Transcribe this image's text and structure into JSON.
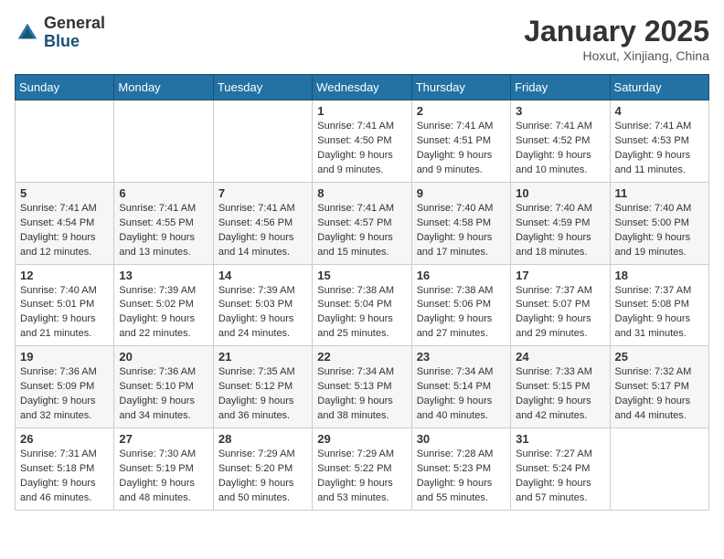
{
  "header": {
    "logo_general": "General",
    "logo_blue": "Blue",
    "month_title": "January 2025",
    "location": "Hoxut, Xinjiang, China"
  },
  "days_of_week": [
    "Sunday",
    "Monday",
    "Tuesday",
    "Wednesday",
    "Thursday",
    "Friday",
    "Saturday"
  ],
  "weeks": [
    [
      {
        "day": "",
        "info": ""
      },
      {
        "day": "",
        "info": ""
      },
      {
        "day": "",
        "info": ""
      },
      {
        "day": "1",
        "info": "Sunrise: 7:41 AM\nSunset: 4:50 PM\nDaylight: 9 hours\nand 9 minutes."
      },
      {
        "day": "2",
        "info": "Sunrise: 7:41 AM\nSunset: 4:51 PM\nDaylight: 9 hours\nand 9 minutes."
      },
      {
        "day": "3",
        "info": "Sunrise: 7:41 AM\nSunset: 4:52 PM\nDaylight: 9 hours\nand 10 minutes."
      },
      {
        "day": "4",
        "info": "Sunrise: 7:41 AM\nSunset: 4:53 PM\nDaylight: 9 hours\nand 11 minutes."
      }
    ],
    [
      {
        "day": "5",
        "info": "Sunrise: 7:41 AM\nSunset: 4:54 PM\nDaylight: 9 hours\nand 12 minutes."
      },
      {
        "day": "6",
        "info": "Sunrise: 7:41 AM\nSunset: 4:55 PM\nDaylight: 9 hours\nand 13 minutes."
      },
      {
        "day": "7",
        "info": "Sunrise: 7:41 AM\nSunset: 4:56 PM\nDaylight: 9 hours\nand 14 minutes."
      },
      {
        "day": "8",
        "info": "Sunrise: 7:41 AM\nSunset: 4:57 PM\nDaylight: 9 hours\nand 15 minutes."
      },
      {
        "day": "9",
        "info": "Sunrise: 7:40 AM\nSunset: 4:58 PM\nDaylight: 9 hours\nand 17 minutes."
      },
      {
        "day": "10",
        "info": "Sunrise: 7:40 AM\nSunset: 4:59 PM\nDaylight: 9 hours\nand 18 minutes."
      },
      {
        "day": "11",
        "info": "Sunrise: 7:40 AM\nSunset: 5:00 PM\nDaylight: 9 hours\nand 19 minutes."
      }
    ],
    [
      {
        "day": "12",
        "info": "Sunrise: 7:40 AM\nSunset: 5:01 PM\nDaylight: 9 hours\nand 21 minutes."
      },
      {
        "day": "13",
        "info": "Sunrise: 7:39 AM\nSunset: 5:02 PM\nDaylight: 9 hours\nand 22 minutes."
      },
      {
        "day": "14",
        "info": "Sunrise: 7:39 AM\nSunset: 5:03 PM\nDaylight: 9 hours\nand 24 minutes."
      },
      {
        "day": "15",
        "info": "Sunrise: 7:38 AM\nSunset: 5:04 PM\nDaylight: 9 hours\nand 25 minutes."
      },
      {
        "day": "16",
        "info": "Sunrise: 7:38 AM\nSunset: 5:06 PM\nDaylight: 9 hours\nand 27 minutes."
      },
      {
        "day": "17",
        "info": "Sunrise: 7:37 AM\nSunset: 5:07 PM\nDaylight: 9 hours\nand 29 minutes."
      },
      {
        "day": "18",
        "info": "Sunrise: 7:37 AM\nSunset: 5:08 PM\nDaylight: 9 hours\nand 31 minutes."
      }
    ],
    [
      {
        "day": "19",
        "info": "Sunrise: 7:36 AM\nSunset: 5:09 PM\nDaylight: 9 hours\nand 32 minutes."
      },
      {
        "day": "20",
        "info": "Sunrise: 7:36 AM\nSunset: 5:10 PM\nDaylight: 9 hours\nand 34 minutes."
      },
      {
        "day": "21",
        "info": "Sunrise: 7:35 AM\nSunset: 5:12 PM\nDaylight: 9 hours\nand 36 minutes."
      },
      {
        "day": "22",
        "info": "Sunrise: 7:34 AM\nSunset: 5:13 PM\nDaylight: 9 hours\nand 38 minutes."
      },
      {
        "day": "23",
        "info": "Sunrise: 7:34 AM\nSunset: 5:14 PM\nDaylight: 9 hours\nand 40 minutes."
      },
      {
        "day": "24",
        "info": "Sunrise: 7:33 AM\nSunset: 5:15 PM\nDaylight: 9 hours\nand 42 minutes."
      },
      {
        "day": "25",
        "info": "Sunrise: 7:32 AM\nSunset: 5:17 PM\nDaylight: 9 hours\nand 44 minutes."
      }
    ],
    [
      {
        "day": "26",
        "info": "Sunrise: 7:31 AM\nSunset: 5:18 PM\nDaylight: 9 hours\nand 46 minutes."
      },
      {
        "day": "27",
        "info": "Sunrise: 7:30 AM\nSunset: 5:19 PM\nDaylight: 9 hours\nand 48 minutes."
      },
      {
        "day": "28",
        "info": "Sunrise: 7:29 AM\nSunset: 5:20 PM\nDaylight: 9 hours\nand 50 minutes."
      },
      {
        "day": "29",
        "info": "Sunrise: 7:29 AM\nSunset: 5:22 PM\nDaylight: 9 hours\nand 53 minutes."
      },
      {
        "day": "30",
        "info": "Sunrise: 7:28 AM\nSunset: 5:23 PM\nDaylight: 9 hours\nand 55 minutes."
      },
      {
        "day": "31",
        "info": "Sunrise: 7:27 AM\nSunset: 5:24 PM\nDaylight: 9 hours\nand 57 minutes."
      },
      {
        "day": "",
        "info": ""
      }
    ]
  ]
}
